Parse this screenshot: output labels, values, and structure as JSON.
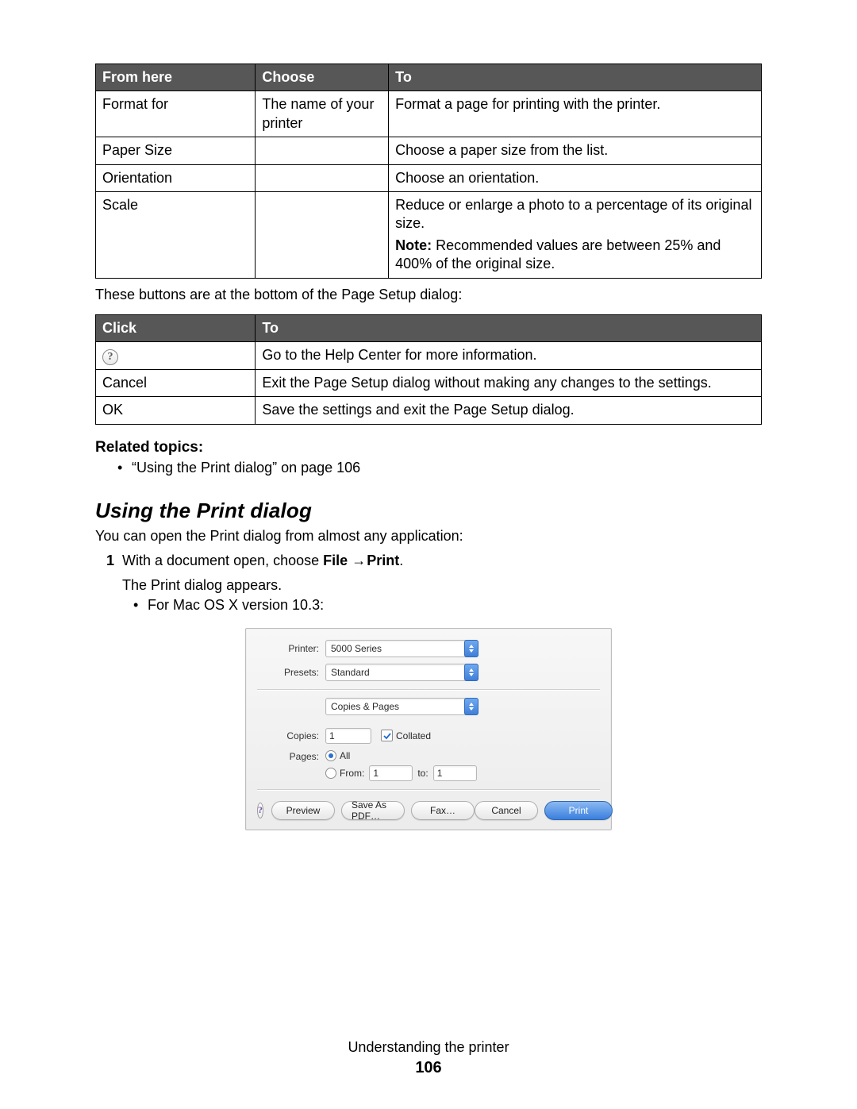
{
  "table1": {
    "headers": [
      "From here",
      "Choose",
      "To"
    ],
    "rows": [
      {
        "c0": "Format for",
        "c1": "The name of your printer",
        "c2": "Format a page for printing with the printer."
      },
      {
        "c0": "Paper Size",
        "c1": "",
        "c2": "Choose a paper size from the list."
      },
      {
        "c0": "Orientation",
        "c1": "",
        "c2": "Choose an orientation."
      },
      {
        "c0": "Scale",
        "c1": "",
        "c2_p1": "Reduce or enlarge a photo to a percentage of its original size.",
        "c2_note_bold": "Note:",
        "c2_note_text": " Recommended values are between 25% and 400% of the original size."
      }
    ]
  },
  "between": "These buttons are at the bottom of the Page Setup dialog:",
  "table2": {
    "headers": [
      "Click",
      "To"
    ],
    "rows": [
      {
        "icon": "?",
        "c1": "Go to the Help Center for more information."
      },
      {
        "c0": "Cancel",
        "c1": "Exit the Page Setup dialog without making any changes to the settings."
      },
      {
        "c0": "OK",
        "c1": "Save the settings and exit the Page Setup dialog."
      }
    ]
  },
  "related_heading": "Related topics:",
  "related_item": "“Using the Print dialog” on page 106",
  "section_heading": "Using the Print dialog",
  "section_intro": "You can open the Print dialog from almost any application:",
  "step1_pre": "With a document open, choose ",
  "step1_bold_file": "File",
  "step1_arrow": "→",
  "step1_bold_print": "Print",
  "step1_period": ".",
  "sub_p": "The Print dialog appears.",
  "sub_bullet": "For Mac OS X version 10.3:",
  "dialog": {
    "printer_label": "Printer:",
    "printer_value": "5000 Series",
    "presets_label": "Presets:",
    "presets_value": "Standard",
    "pane_value": "Copies & Pages",
    "copies_label": "Copies:",
    "copies_value": "1",
    "collated_label": "Collated",
    "pages_label": "Pages:",
    "opt_all": "All",
    "opt_from": "From:",
    "from_value": "1",
    "to_label": "to:",
    "to_value": "1",
    "help_glyph": "?",
    "btn_preview": "Preview",
    "btn_savepdf": "Save As PDF…",
    "btn_fax": "Fax…",
    "btn_cancel": "Cancel",
    "btn_print": "Print"
  },
  "footer": {
    "chapter": "Understanding the printer",
    "page": "106"
  }
}
